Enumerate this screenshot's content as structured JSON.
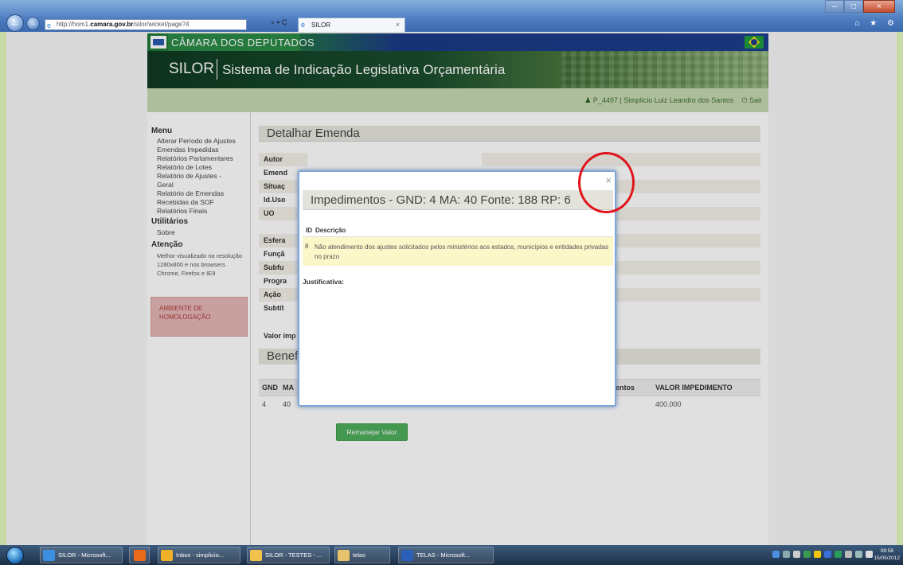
{
  "browser": {
    "address_prefix": "http://hom1.",
    "address_domain": "camara.gov.br",
    "address_path": "/silor/wicket/page?4",
    "address_controls": "⌕ ▾ C",
    "tab_title": "SILOR",
    "tab_close": "×",
    "window_controls": [
      "–",
      "□",
      "×"
    ],
    "tools": "⌂ ★ ⚙"
  },
  "site": {
    "camara_title": "CÂMARA DOS DEPUTADOS",
    "silor_acronym": "SILOR",
    "silor_fullname": "Sistema de Indicação Legislativa Orçamentária",
    "user_label": "P_4497 | Simplicio Luiz Leandro dos Santos",
    "logout_label": "Sair"
  },
  "sidebar": {
    "menu_heading": "Menu",
    "menu_items": [
      "Alterar Período de Ajustes",
      "Emendas Impedidas",
      "Relatórios Parlamentares",
      "Relatório de Lotes",
      "Relatório de Ajustes -",
      "Geral",
      "Relatório de Emendas",
      "Recebidas da SOF",
      "Relatórios Finais"
    ],
    "utilitarios_heading": "Utilitários",
    "utilitarios_items": [
      "Sobre"
    ],
    "atencao_heading": "Atenção",
    "atencao_note": "Melhor visualizado na resolução 1280x800 e nos browsers Chrome, Firefox e IE9",
    "ambiente_label": "AMBIENTE DE HOMOLOGAÇÃO"
  },
  "main": {
    "heading": "Detalhar Emenda",
    "fields": [
      "Autor",
      "Emend",
      "Situaç",
      "Id.Uso",
      "UO",
      "",
      "Esfera",
      "Funçã",
      "Subfu",
      "Progra",
      "Ação",
      "Subtít"
    ],
    "valor_label": "Valor imp",
    "benef_heading": "Benef",
    "table_headers": {
      "gnd": "GND",
      "ma": "MA",
      "fragment": "mentos",
      "valor": "VALOR IMPEDIMENTO"
    },
    "table_row": {
      "gnd": "4",
      "ma": "40",
      "valor": "400.000"
    },
    "remanejar_label": "Remanejar Valor"
  },
  "modal": {
    "title": "Impedimentos - GND: 4 MA: 40 Fonte: 188 RP: 6",
    "close": "×",
    "col_id": "ID",
    "col_desc": "Descrição",
    "row_id": "8",
    "row_desc": "Não atendimento dos ajustes solicitados pelos ministérios aos estados, municípios e entidades privadas no prazo",
    "justificativa_label": "Justificativa:"
  },
  "taskbar": {
    "items": [
      "SILOR - Microsoft...",
      "Inbox - simplicio...",
      "SILOR - TESTES - ...",
      "telas",
      "TELAS - Microsoft..."
    ],
    "time": "08:58",
    "date": "15/05/2012"
  },
  "colors": {
    "accent_green": "#4fad5b",
    "banner_green": "#1a4d2e",
    "camara_blue": "#1d3d8c",
    "highlight_red": "#e0141a",
    "row_highlight": "#fbf7c8"
  }
}
